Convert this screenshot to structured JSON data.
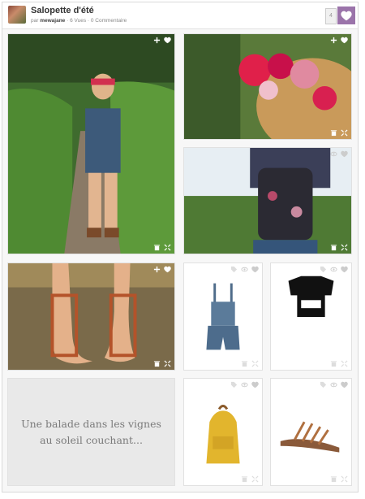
{
  "post": {
    "title": "Salopette d'été",
    "by_prefix": "par",
    "author": "mewajane",
    "stats": "· 6 Vues · 0 Commentaire",
    "like_count": "4"
  },
  "tiles": {
    "caption": "Une balade dans les vignes au soleil couchant..."
  },
  "colors": {
    "accent": "#9b74aa",
    "card_bg": "#f7f7f7",
    "text_tile_bg": "#e9e9e9"
  },
  "icons": [
    "plus-icon",
    "heart-icon",
    "eye-icon",
    "tag-icon",
    "trash-icon",
    "expand-icon"
  ]
}
